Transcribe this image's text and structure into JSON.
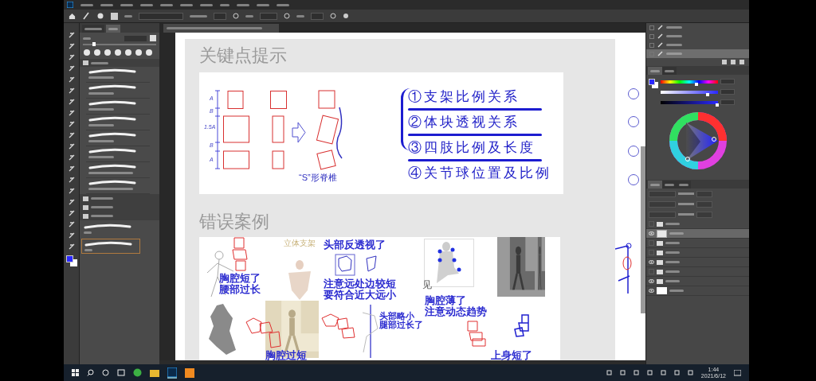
{
  "brush_panel": {
    "tabs": [
      {
        "selected": false
      },
      {
        "selected": true
      }
    ],
    "size_slider": {
      "level": 0.15
    }
  },
  "slide": {
    "title": "关键点提示",
    "diagram_labels": [
      "A",
      "B",
      "1.5A",
      "B",
      "A"
    ],
    "spine_caption": "“S”形脊椎",
    "points": [
      {
        "text": "①支架比例关系",
        "underlined": true
      },
      {
        "text": "②体块透视关系",
        "underlined": true
      },
      {
        "text": "③四肢比例及长度",
        "underlined": true
      },
      {
        "text": "④关节球位置及比例",
        "underlined": false
      }
    ],
    "section_title": "错误案例",
    "annotations": [
      {
        "lines": [
          "立体支架"
        ],
        "kind": "faint"
      },
      {
        "lines": [
          "头部反透视了"
        ],
        "kind": "note"
      },
      {
        "lines": [
          "胸腔短了",
          "腰部过长"
        ],
        "kind": "note"
      },
      {
        "lines": [
          "注意远处边较短",
          "要符合近大远小"
        ],
        "kind": "note"
      },
      {
        "lines": [
          "见"
        ],
        "kind": "caption"
      },
      {
        "lines": [
          "胸腔薄了",
          "注意动态趋势"
        ],
        "kind": "note"
      },
      {
        "lines": [
          "头部略小",
          "腿部过长了"
        ],
        "kind": "small"
      },
      {
        "lines": [
          "胸腔过短"
        ],
        "kind": "note"
      },
      {
        "lines": [
          "上身短了"
        ],
        "kind": "note"
      }
    ]
  },
  "history": [
    {
      "checked": false,
      "selected": false
    },
    {
      "checked": false,
      "selected": false
    },
    {
      "checked": false,
      "selected": false
    },
    {
      "checked": false,
      "selected": true
    }
  ],
  "color_panel": {
    "tabs": [
      {
        "selected": true
      },
      {
        "selected": false
      }
    ],
    "sliders": [
      {
        "level": 0.62
      },
      {
        "level": 0.82
      },
      {
        "level": 0.98
      }
    ]
  },
  "layers_panel": {
    "tabs": [
      {
        "selected": true
      },
      {
        "selected": false
      },
      {
        "selected": false
      }
    ]
  },
  "layers": [
    {
      "kind": "folder",
      "visible": false,
      "selected": false
    },
    {
      "kind": "layer",
      "visible": true,
      "selected": true
    },
    {
      "kind": "folder",
      "visible": false,
      "selected": false
    },
    {
      "kind": "folder",
      "visible": false,
      "selected": false
    },
    {
      "kind": "folder",
      "visible": true,
      "selected": false
    },
    {
      "kind": "folder",
      "visible": false,
      "selected": false
    },
    {
      "kind": "folder",
      "visible": true,
      "selected": false
    },
    {
      "kind": "background",
      "visible": true,
      "selected": false
    }
  ],
  "taskbar": {
    "time": "1:44",
    "date": "2021/6/12"
  }
}
